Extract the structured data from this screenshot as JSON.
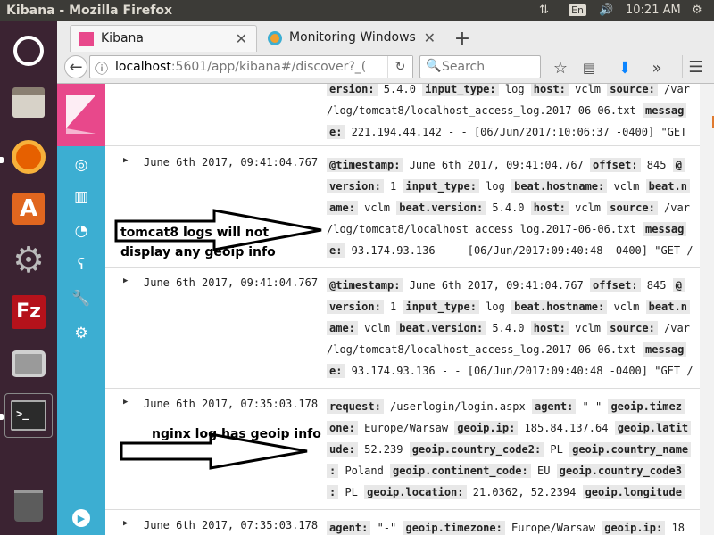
{
  "top_bar": {
    "title": "Kibana - Mozilla Firefox",
    "keyboard": "En",
    "clock": "10:21 AM"
  },
  "launcher": {
    "items": [
      {
        "name": "ubuntu-dash",
        "color": "#c84891"
      },
      {
        "name": "files",
        "color": "#8a7f72"
      },
      {
        "name": "firefox",
        "color": "#e66000"
      },
      {
        "name": "software-center",
        "color": "#e0661f"
      },
      {
        "name": "system-settings",
        "color": "#6b6b6b"
      },
      {
        "name": "filezilla",
        "color": "#b5121b"
      },
      {
        "name": "screenshot",
        "color": "#9a9a9a"
      },
      {
        "name": "terminal",
        "color": "#2b2b2b"
      },
      {
        "name": "trash",
        "color": "#5c5c5c"
      }
    ]
  },
  "browser": {
    "tabs": [
      {
        "label": "Kibana"
      },
      {
        "label": "Monitoring Windows I"
      }
    ],
    "new_tab": "+",
    "url": {
      "host": "localhost",
      "rest": ":5601/app/kibana#/discover?_("
    },
    "search_placeholder": "Search"
  },
  "rows": [
    {
      "timestamp": "",
      "lines": [
        [
          {
            "k": "ersion:"
          },
          {
            "t": " 5.4.0 "
          },
          {
            "k": "input_type:"
          },
          {
            "t": " log "
          },
          {
            "k": "host:"
          },
          {
            "t": " vclm "
          },
          {
            "k": "source:"
          },
          {
            "t": " /var"
          }
        ],
        [
          {
            "t": "/log/tomcat8/localhost_access_log.2017-06-06.txt "
          },
          {
            "k": "messag"
          }
        ],
        [
          {
            "k": "e:"
          },
          {
            "t": " 221.194.44.142 - - [06/Jun/2017:10:06:37 -0400] \"GET"
          }
        ]
      ]
    },
    {
      "timestamp": "June 6th 2017, 09:41:04.767",
      "lines": [
        [
          {
            "k": "@timestamp:"
          },
          {
            "t": " June 6th 2017, 09:41:04.767 "
          },
          {
            "k": "offset:"
          },
          {
            "t": " 845 "
          },
          {
            "k": "@"
          }
        ],
        [
          {
            "k": "version:"
          },
          {
            "t": " 1 "
          },
          {
            "k": "input_type:"
          },
          {
            "t": " log "
          },
          {
            "k": "beat.hostname:"
          },
          {
            "t": " vclm "
          },
          {
            "k": "beat.n"
          }
        ],
        [
          {
            "k": "ame:"
          },
          {
            "t": " vclm "
          },
          {
            "k": "beat.version:"
          },
          {
            "t": " 5.4.0 "
          },
          {
            "k": "host:"
          },
          {
            "t": " vclm "
          },
          {
            "k": "source:"
          },
          {
            "t": " /var"
          }
        ],
        [
          {
            "t": "/log/tomcat8/localhost_access_log.2017-06-06.txt "
          },
          {
            "k": "messag"
          }
        ],
        [
          {
            "k": "e:"
          },
          {
            "t": " 93.174.93.136 - - [06/Jun/2017:09:40:48 -0400] \"GET /"
          }
        ]
      ]
    },
    {
      "timestamp": "June 6th 2017, 09:41:04.767",
      "lines": [
        [
          {
            "k": "@timestamp:"
          },
          {
            "t": " June 6th 2017, 09:41:04.767 "
          },
          {
            "k": "offset:"
          },
          {
            "t": " 845 "
          },
          {
            "k": "@"
          }
        ],
        [
          {
            "k": "version:"
          },
          {
            "t": " 1 "
          },
          {
            "k": "input_type:"
          },
          {
            "t": " log "
          },
          {
            "k": "beat.hostname:"
          },
          {
            "t": " vclm "
          },
          {
            "k": "beat.n"
          }
        ],
        [
          {
            "k": "ame:"
          },
          {
            "t": " vclm "
          },
          {
            "k": "beat.version:"
          },
          {
            "t": " 5.4.0 "
          },
          {
            "k": "host:"
          },
          {
            "t": " vclm "
          },
          {
            "k": "source:"
          },
          {
            "t": " /var"
          }
        ],
        [
          {
            "t": "/log/tomcat8/localhost_access_log.2017-06-06.txt "
          },
          {
            "k": "messag"
          }
        ],
        [
          {
            "k": "e:"
          },
          {
            "t": " 93.174.93.136 - - [06/Jun/2017:09:40:48 -0400] \"GET /"
          }
        ]
      ]
    },
    {
      "timestamp": "June 6th 2017, 07:35:03.178",
      "lines": [
        [
          {
            "k": "request:"
          },
          {
            "t": " /userlogin/login.aspx "
          },
          {
            "k": "agent:"
          },
          {
            "t": " \"-\" "
          },
          {
            "k": "geoip.timez"
          }
        ],
        [
          {
            "k": "one:"
          },
          {
            "t": " Europe/Warsaw "
          },
          {
            "k": "geoip.ip:"
          },
          {
            "t": " 185.84.137.64 "
          },
          {
            "k": "geoip.latit"
          }
        ],
        [
          {
            "k": "ude:"
          },
          {
            "t": " 52.239 "
          },
          {
            "k": "geoip.country_code2:"
          },
          {
            "t": " PL "
          },
          {
            "k": "geoip.country_name"
          }
        ],
        [
          {
            "k": ":"
          },
          {
            "t": " Poland "
          },
          {
            "k": "geoip.continent_code:"
          },
          {
            "t": " EU "
          },
          {
            "k": "geoip.country_code3"
          }
        ],
        [
          {
            "k": ":"
          },
          {
            "t": " PL "
          },
          {
            "k": "geoip.location:"
          },
          {
            "t": " 21.0362, 52.2394 "
          },
          {
            "k": "geoip.longitude"
          }
        ]
      ]
    },
    {
      "timestamp": "June 6th 2017, 07:35:03.178",
      "lines": [
        [
          {
            "k": "agent:"
          },
          {
            "t": " \"-\" "
          },
          {
            "k": "geoip.timezone:"
          },
          {
            "t": " Europe/Warsaw "
          },
          {
            "k": "geoip.ip:"
          },
          {
            "t": " 18"
          }
        ]
      ]
    }
  ],
  "annotations": {
    "tomcat": "tomcat8 logs will not\ndisplay any geoip info",
    "nginx": "nginx log has geoip info"
  }
}
